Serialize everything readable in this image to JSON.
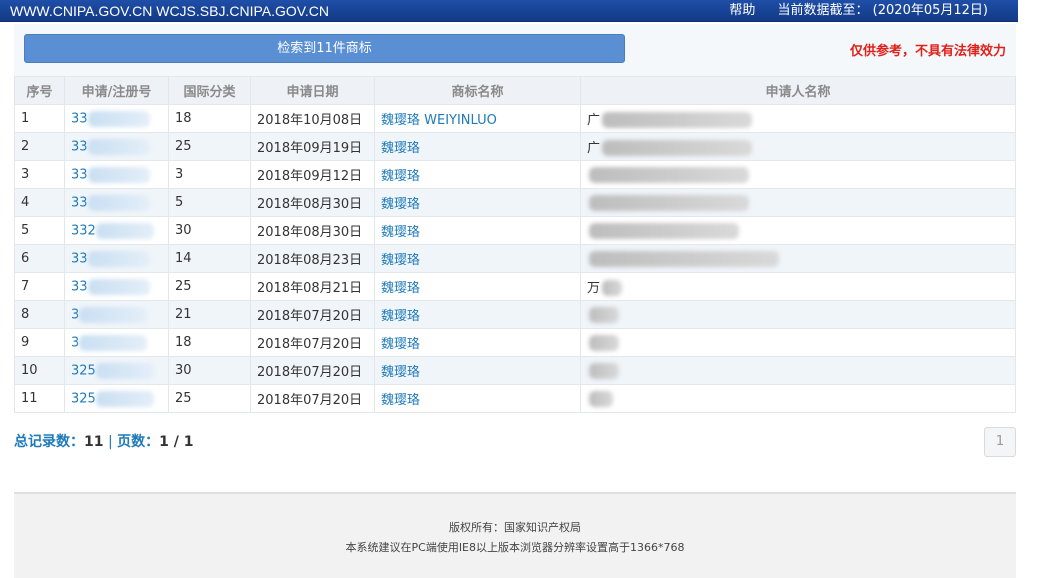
{
  "header": {
    "site": "WWW.CNIPA.GOV.CN WCJS.SBJ.CNIPA.GOV.CN",
    "help": "帮助",
    "data_date": "当前数据截至： (2020年05月12日)"
  },
  "result": {
    "button": "检索到11件商标",
    "disclaimer": "仅供参考，不具有法律效力"
  },
  "table": {
    "headers": [
      "序号",
      "申请/注册号",
      "国际分类",
      "申请日期",
      "商标名称",
      "申请人名称"
    ],
    "rows": [
      {
        "no": "1",
        "reg": "33",
        "cls": "18",
        "date": "2018年10月08日",
        "name": "魏璎珞 WEIYINLUO",
        "applicant": "广"
      },
      {
        "no": "2",
        "reg": "33",
        "cls": "25",
        "date": "2018年09月19日",
        "name": "魏璎珞",
        "applicant": "广"
      },
      {
        "no": "3",
        "reg": "33",
        "cls": "3",
        "date": "2018年09月12日",
        "name": "魏璎珞",
        "applicant": ""
      },
      {
        "no": "4",
        "reg": "33",
        "cls": "5",
        "date": "2018年08月30日",
        "name": "魏璎珞",
        "applicant": ""
      },
      {
        "no": "5",
        "reg": "332",
        "cls": "30",
        "date": "2018年08月30日",
        "name": "魏璎珞",
        "applicant": ""
      },
      {
        "no": "6",
        "reg": "33",
        "cls": "14",
        "date": "2018年08月23日",
        "name": "魏璎珞",
        "applicant": ""
      },
      {
        "no": "7",
        "reg": "33",
        "cls": "25",
        "date": "2018年08月21日",
        "name": "魏璎珞",
        "applicant": "万"
      },
      {
        "no": "8",
        "reg": "3",
        "cls": "21",
        "date": "2018年07月20日",
        "name": "魏璎珞",
        "applicant": ""
      },
      {
        "no": "9",
        "reg": "3",
        "cls": "18",
        "date": "2018年07月20日",
        "name": "魏璎珞",
        "applicant": ""
      },
      {
        "no": "10",
        "reg": "325",
        "cls": "30",
        "date": "2018年07月20日",
        "name": "魏璎珞",
        "applicant": ""
      },
      {
        "no": "11",
        "reg": "325",
        "cls": "25",
        "date": "2018年07月20日",
        "name": "魏璎珞",
        "applicant": ""
      }
    ]
  },
  "pager": {
    "total_label": "总记录数：",
    "total": "11",
    "sep": "|",
    "pages_label": "页数：",
    "pages": "1 / 1",
    "current_page": "1"
  },
  "footer": {
    "copyright": "版权所有：国家知识产权局",
    "note": "本系统建议在PC端使用IE8以上版本浏览器分辨率设置高于1366*768"
  }
}
